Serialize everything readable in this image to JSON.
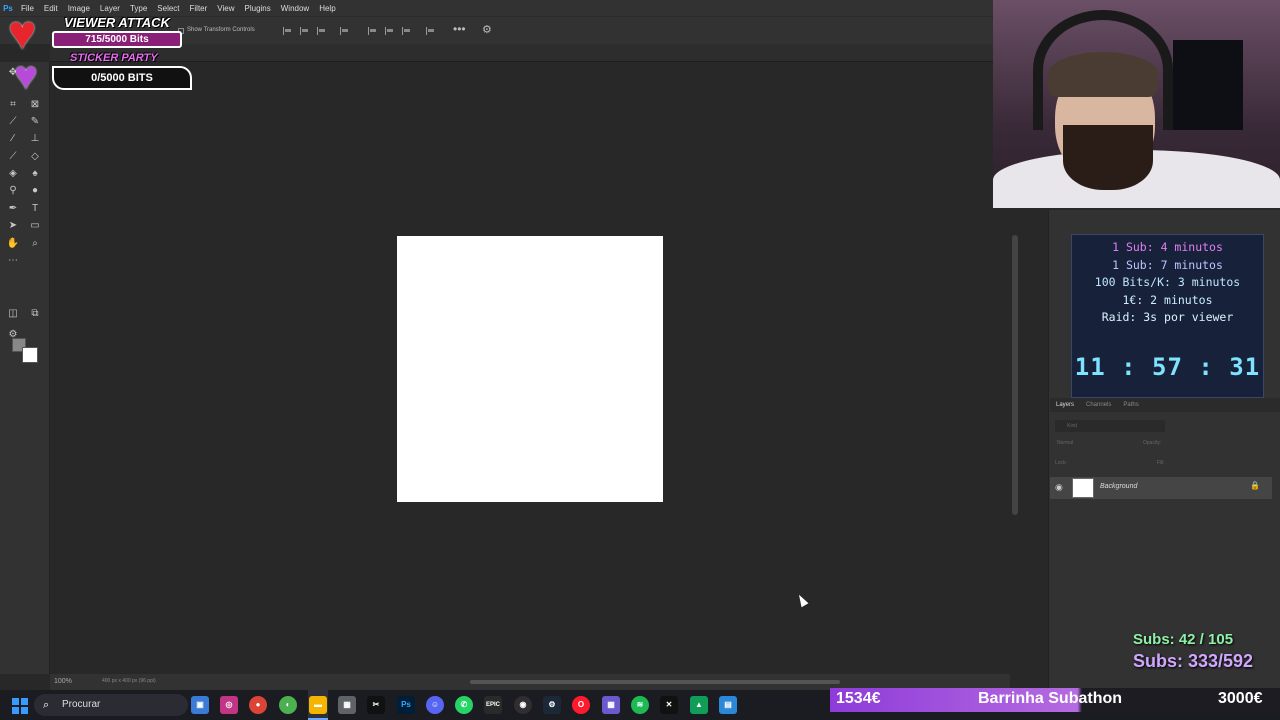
{
  "menu": {
    "app_logo": "Ps",
    "items": [
      "File",
      "Edit",
      "Image",
      "Layer",
      "Type",
      "Select",
      "Filter",
      "View",
      "Plugins",
      "Window",
      "Help"
    ]
  },
  "options_bar": {
    "show_transform_label": "Show Transform Controls",
    "more_glyph": "•••",
    "gear_icon": "settings-icon"
  },
  "status_bar": {
    "zoom": "100%",
    "doc_info": "400 px x 400 px (96 ppi)"
  },
  "overlay_viewer_attack": {
    "title": "VIEWER ATTACK",
    "progress_text": "715/5000 Bits",
    "sticker_title": "STICKER PARTY",
    "sticker_progress": "0/5000 BITS"
  },
  "timer": {
    "lines": [
      "1 Sub: 4 minutos",
      "1 Sub: 7 minutos",
      "100 Bits/K: 3 minutos",
      "1€: 2 minutos",
      "Raid: 3s por viewer"
    ],
    "clock": "11 : 57 : 31"
  },
  "layers_panel": {
    "tabs": [
      "Layers",
      "Channels",
      "Paths"
    ],
    "active_tab": "Layers",
    "filter_placeholder": "Kind",
    "blend_mode": "Normal",
    "opacity_label": "Opacity:",
    "lock_label": "Lock:",
    "fill_label": "Fill:",
    "layer_name": "Background"
  },
  "subs_overlay": {
    "line1": "Subs: 42 / 105",
    "line2": "Subs: 333/592"
  },
  "taskbar": {
    "search_placeholder": "Procurar",
    "apps": [
      "file-explorer",
      "instagram",
      "chrome",
      "browser-green",
      "folder",
      "calculator",
      "capcut",
      "photoshop",
      "discord",
      "whatsapp",
      "epic-games",
      "obs",
      "steam",
      "opera",
      "grid-app",
      "spotify",
      "capcut-2",
      "google-drive",
      "notepad"
    ]
  },
  "subathon_bar": {
    "left": "1534€",
    "label": "Barrinha Subathon",
    "right": "3000€",
    "progress": 0.511
  }
}
